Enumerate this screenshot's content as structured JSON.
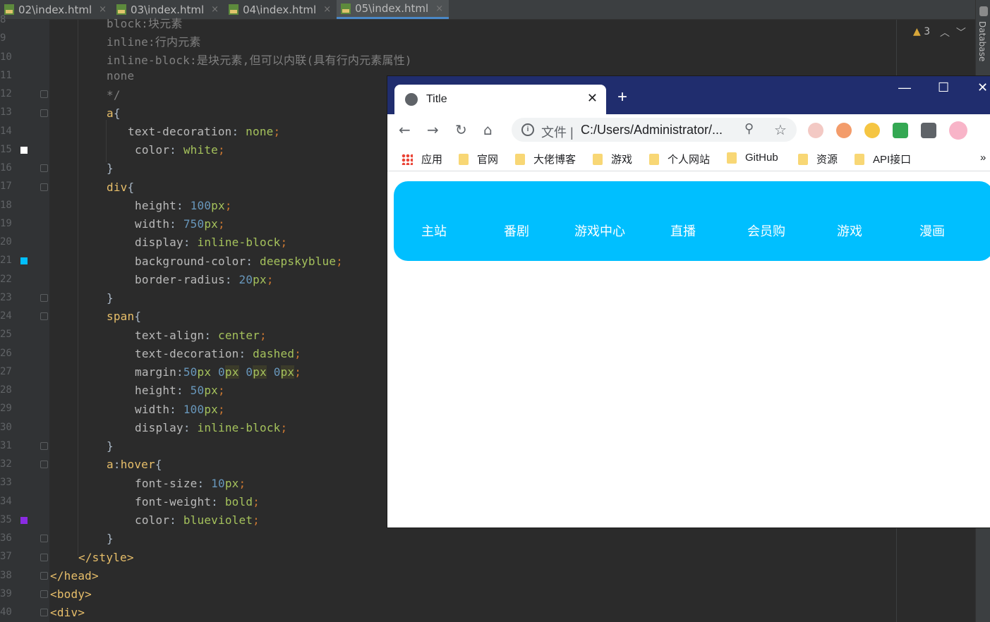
{
  "ide": {
    "tabs": [
      {
        "label": "02\\index.html",
        "close": "×"
      },
      {
        "label": "03\\index.html",
        "close": "×"
      },
      {
        "label": "04\\index.html",
        "close": "×"
      },
      {
        "label": "05\\index.html",
        "close": "×"
      }
    ],
    "active_tab": 3,
    "warnings": {
      "icon": "warning-icon",
      "count": "3"
    },
    "side_panel": "Database",
    "line_numbers": [
      "8",
      "9",
      "10",
      "11",
      "12",
      "13",
      "14",
      "15",
      "16",
      "17",
      "18",
      "19",
      "20",
      "21",
      "22",
      "23",
      "24",
      "25",
      "26",
      "27",
      "28",
      "29",
      "30",
      "31",
      "32",
      "33",
      "34",
      "35",
      "36",
      "37",
      "38",
      "39",
      "40"
    ],
    "color_swatches": {
      "white": "#ffffff",
      "deepskyblue": "#00bfff",
      "blueviolet": "#8a2be2"
    }
  },
  "browser": {
    "tab_title": "Title",
    "tab_icon": "globe-icon",
    "new_tab": "+",
    "window_controls": {
      "minimize": "—",
      "maximize": "☐",
      "close": "✕"
    },
    "address": {
      "scheme_label": "文件 |",
      "url": "C:/Users/Administrator/..."
    },
    "bookmarks": [
      "应用",
      "官网",
      "大佬博客",
      "游戏",
      "个人网站",
      "GitHub",
      "资源",
      "API接口"
    ],
    "bookmarks_overflow": "»",
    "page": {
      "nav_color": "#00bfff",
      "nav_links": [
        "主站",
        "番剧",
        "游戏中心",
        "直播",
        "会员购",
        "游戏",
        "漫画"
      ]
    }
  }
}
